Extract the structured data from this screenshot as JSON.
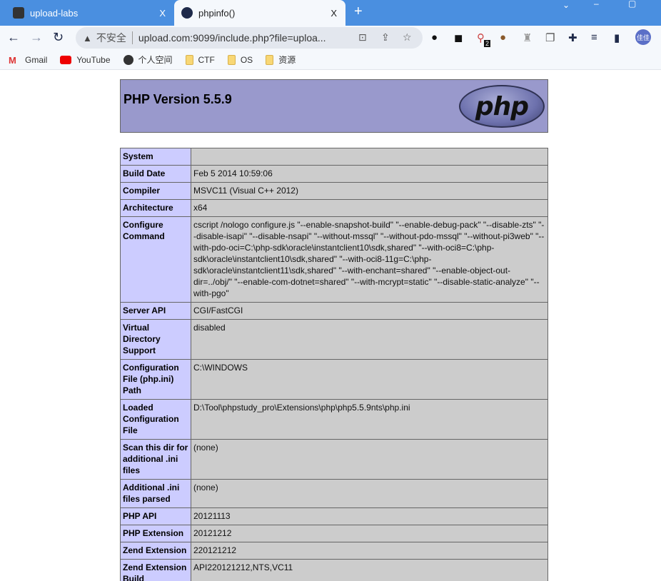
{
  "browser": {
    "tabs": [
      {
        "title": "upload-labs",
        "close": "X"
      },
      {
        "title": "phpinfo()",
        "close": "X"
      }
    ],
    "new_tab": "+",
    "url": "upload.com:9099/include.php?file=uploa...",
    "security_label": "不安全",
    "profile": "佳佳",
    "extension_badge": "2",
    "bookmarks": [
      "Gmail",
      "YouTube",
      "个人空间",
      "CTF",
      "OS",
      "资源"
    ]
  },
  "php": {
    "title": "PHP Version 5.5.9",
    "logo_text": "php",
    "rows": [
      {
        "label": "System",
        "value": ""
      },
      {
        "label": "Build Date",
        "value": "Feb 5 2014 10:59:06"
      },
      {
        "label": "Compiler",
        "value": "MSVC11 (Visual C++ 2012)"
      },
      {
        "label": "Architecture",
        "value": "x64"
      },
      {
        "label": "Configure Command",
        "value": "cscript /nologo configure.js \"--enable-snapshot-build\" \"--enable-debug-pack\" \"--disable-zts\" \"--disable-isapi\" \"--disable-nsapi\" \"--without-mssql\" \"--without-pdo-mssql\" \"--without-pi3web\" \"--with-pdo-oci=C:\\php-sdk\\oracle\\instantclient10\\sdk,shared\" \"--with-oci8=C:\\php-sdk\\oracle\\instantclient10\\sdk,shared\" \"--with-oci8-11g=C:\\php-sdk\\oracle\\instantclient11\\sdk,shared\" \"--with-enchant=shared\" \"--enable-object-out-dir=../obj/\" \"--enable-com-dotnet=shared\" \"--with-mcrypt=static\" \"--disable-static-analyze\" \"--with-pgo\""
      },
      {
        "label": "Server API",
        "value": "CGI/FastCGI"
      },
      {
        "label": "Virtual Directory Support",
        "value": "disabled"
      },
      {
        "label": "Configuration File (php.ini) Path",
        "value": "C:\\WINDOWS"
      },
      {
        "label": "Loaded Configuration File",
        "value": "D:\\Tool\\phpstudy_pro\\Extensions\\php\\php5.5.9nts\\php.ini"
      },
      {
        "label": "Scan this dir for additional .ini files",
        "value": "(none)"
      },
      {
        "label": "Additional .ini files parsed",
        "value": "(none)"
      },
      {
        "label": "PHP API",
        "value": "20121113"
      },
      {
        "label": "PHP Extension",
        "value": "20121212"
      },
      {
        "label": "Zend Extension",
        "value": "220121212"
      },
      {
        "label": "Zend Extension Build",
        "value": "API220121212,NTS,VC11"
      }
    ]
  }
}
